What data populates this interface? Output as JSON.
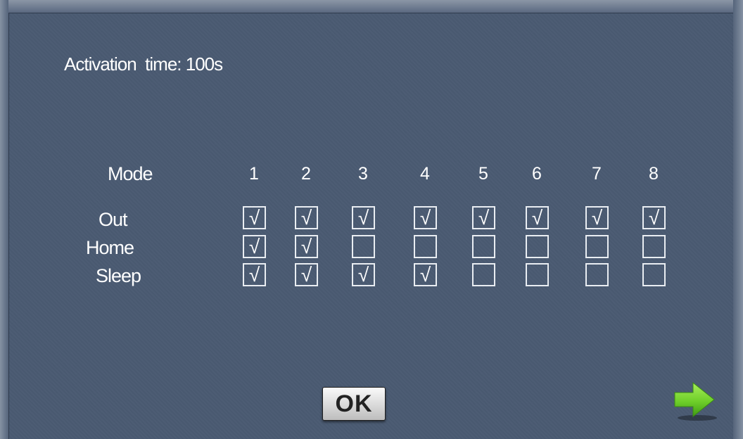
{
  "activation": {
    "label": "Activation  time: 100s"
  },
  "table": {
    "header_label": "Mode",
    "columns": [
      "1",
      "2",
      "3",
      "4",
      "5",
      "6",
      "7",
      "8"
    ],
    "rows": [
      {
        "label": "Out",
        "checked": [
          true,
          true,
          true,
          true,
          true,
          true,
          true,
          true
        ]
      },
      {
        "label": "Home",
        "checked": [
          true,
          true,
          false,
          false,
          false,
          false,
          false,
          false
        ]
      },
      {
        "label": "Sleep",
        "checked": [
          true,
          true,
          true,
          true,
          false,
          false,
          false,
          false
        ]
      }
    ],
    "check_glyph": "√"
  },
  "buttons": {
    "ok_label": "OK",
    "next_icon": "right-arrow-icon"
  },
  "colors": {
    "background": "#4a5a72",
    "text": "#ffffff",
    "arrow": "#7ed321"
  }
}
